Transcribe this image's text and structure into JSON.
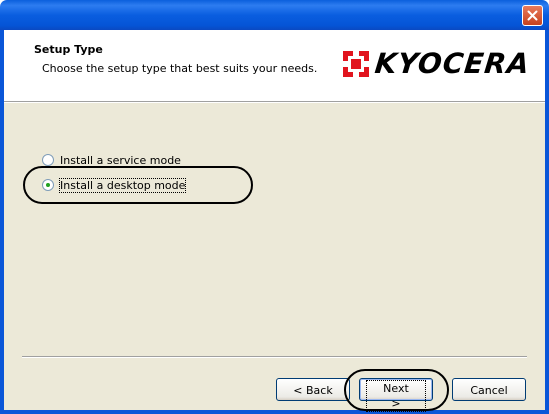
{
  "dialog": {
    "header": {
      "title": "Setup Type",
      "subtitle": "Choose the setup type that best suits your needs.",
      "logo_text": "KYOCERA"
    },
    "options": [
      {
        "label": "Install a service mode",
        "checked": false
      },
      {
        "label": "Install a desktop mode",
        "checked": true
      }
    ],
    "buttons": {
      "back": "< Back",
      "next": "Next >",
      "cancel": "Cancel"
    }
  },
  "colors": {
    "titlebar": "#0a56d8",
    "body_bg": "#ece9d8",
    "logo_red": "#e1141e",
    "close_button": "#d35a37"
  },
  "icons": {
    "close": "close-icon",
    "logo_mark": "kyocera-logo-icon"
  }
}
